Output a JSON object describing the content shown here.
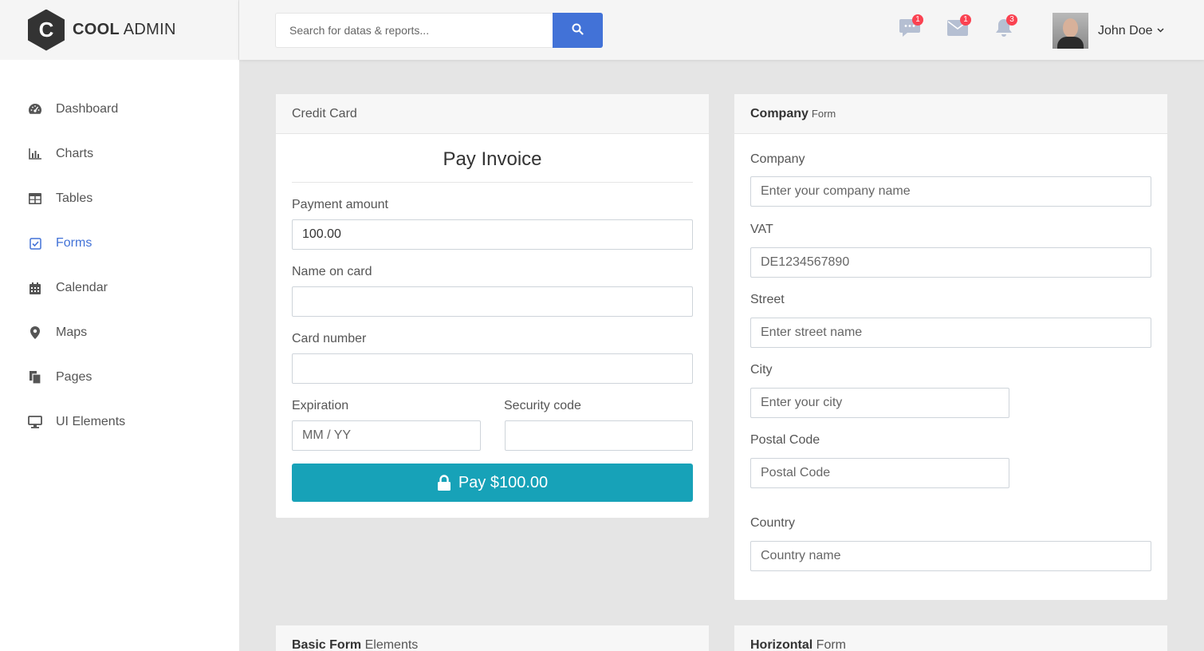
{
  "brand": {
    "letter": "C",
    "bold": "COOL",
    "rest": "ADMIN"
  },
  "sidebar": {
    "items": [
      {
        "label": "Dashboard",
        "icon": "dashboard-icon"
      },
      {
        "label": "Charts",
        "icon": "bar-chart-icon"
      },
      {
        "label": "Tables",
        "icon": "table-icon"
      },
      {
        "label": "Forms",
        "icon": "check-square-icon",
        "active": true
      },
      {
        "label": "Calendar",
        "icon": "calendar-icon"
      },
      {
        "label": "Maps",
        "icon": "map-marker-icon"
      },
      {
        "label": "Pages",
        "icon": "copy-icon"
      },
      {
        "label": "UI Elements",
        "icon": "desktop-icon"
      }
    ]
  },
  "header": {
    "search_placeholder": "Search for datas & reports...",
    "notifications": {
      "messages": "1",
      "mail": "1",
      "alerts": "3"
    },
    "user_name": "John Doe"
  },
  "credit_card": {
    "header": "Credit Card",
    "title": "Pay Invoice",
    "payment_amount_label": "Payment amount",
    "payment_amount_value": "100.00",
    "name_label": "Name on card",
    "card_number_label": "Card number",
    "expiration_label": "Expiration",
    "expiration_placeholder": "MM / YY",
    "security_label": "Security code",
    "pay_button": "Pay $100.00"
  },
  "company_form": {
    "header_bold": "Company",
    "header_small": "Form",
    "company_label": "Company",
    "company_placeholder": "Enter your company name",
    "vat_label": "VAT",
    "vat_placeholder": "DE1234567890",
    "street_label": "Street",
    "street_placeholder": "Enter street name",
    "city_label": "City",
    "city_placeholder": "Enter your city",
    "postal_label": "Postal Code",
    "postal_placeholder": "Postal Code",
    "country_label": "Country",
    "country_placeholder": "Country name"
  },
  "basic_form": {
    "header_bold": "Basic Form",
    "header_rest": "Elements"
  },
  "horizontal_form": {
    "header_bold": "Horizontal",
    "header_rest": "Form"
  },
  "colors": {
    "primary": "#4272d7",
    "info": "#17a2b8",
    "badge": "#fa4251",
    "dark": "#333333"
  }
}
